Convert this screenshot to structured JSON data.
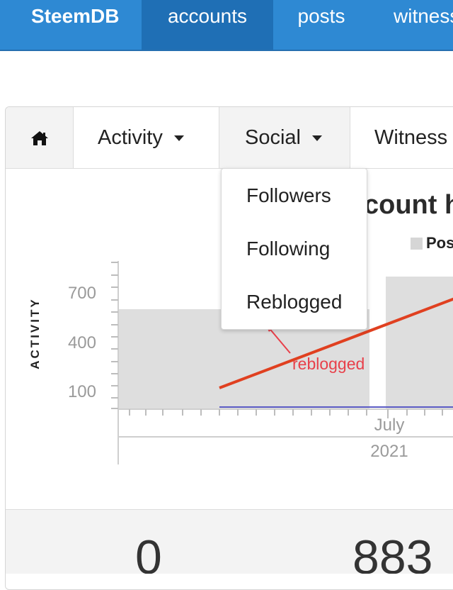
{
  "navbar": {
    "brand": "SteemDB",
    "items": [
      {
        "label": "accounts"
      },
      {
        "label": "posts"
      },
      {
        "label": "witnesses"
      }
    ]
  },
  "tabs": {
    "activity": "Activity",
    "social": "Social",
    "witness": "Witness"
  },
  "dropdown": {
    "items": [
      "Followers",
      "Following",
      "Reblogged"
    ]
  },
  "chart": {
    "title": "count h",
    "legend_label": "Posts",
    "ylabel": "ACTIVITY",
    "yticks": [
      "700",
      "400",
      "100"
    ],
    "xtick_month": "July",
    "xtick_year": "2021"
  },
  "annotation": {
    "text": "reblogged",
    "color": "#e8404a"
  },
  "stats": [
    "0",
    "883"
  ],
  "colors": {
    "navbar": "#2e89d3",
    "navbar_active": "#1f6fb5",
    "bar": "#dedede",
    "trend_line": "#e04020",
    "baseline": "#5b5bc4"
  }
}
